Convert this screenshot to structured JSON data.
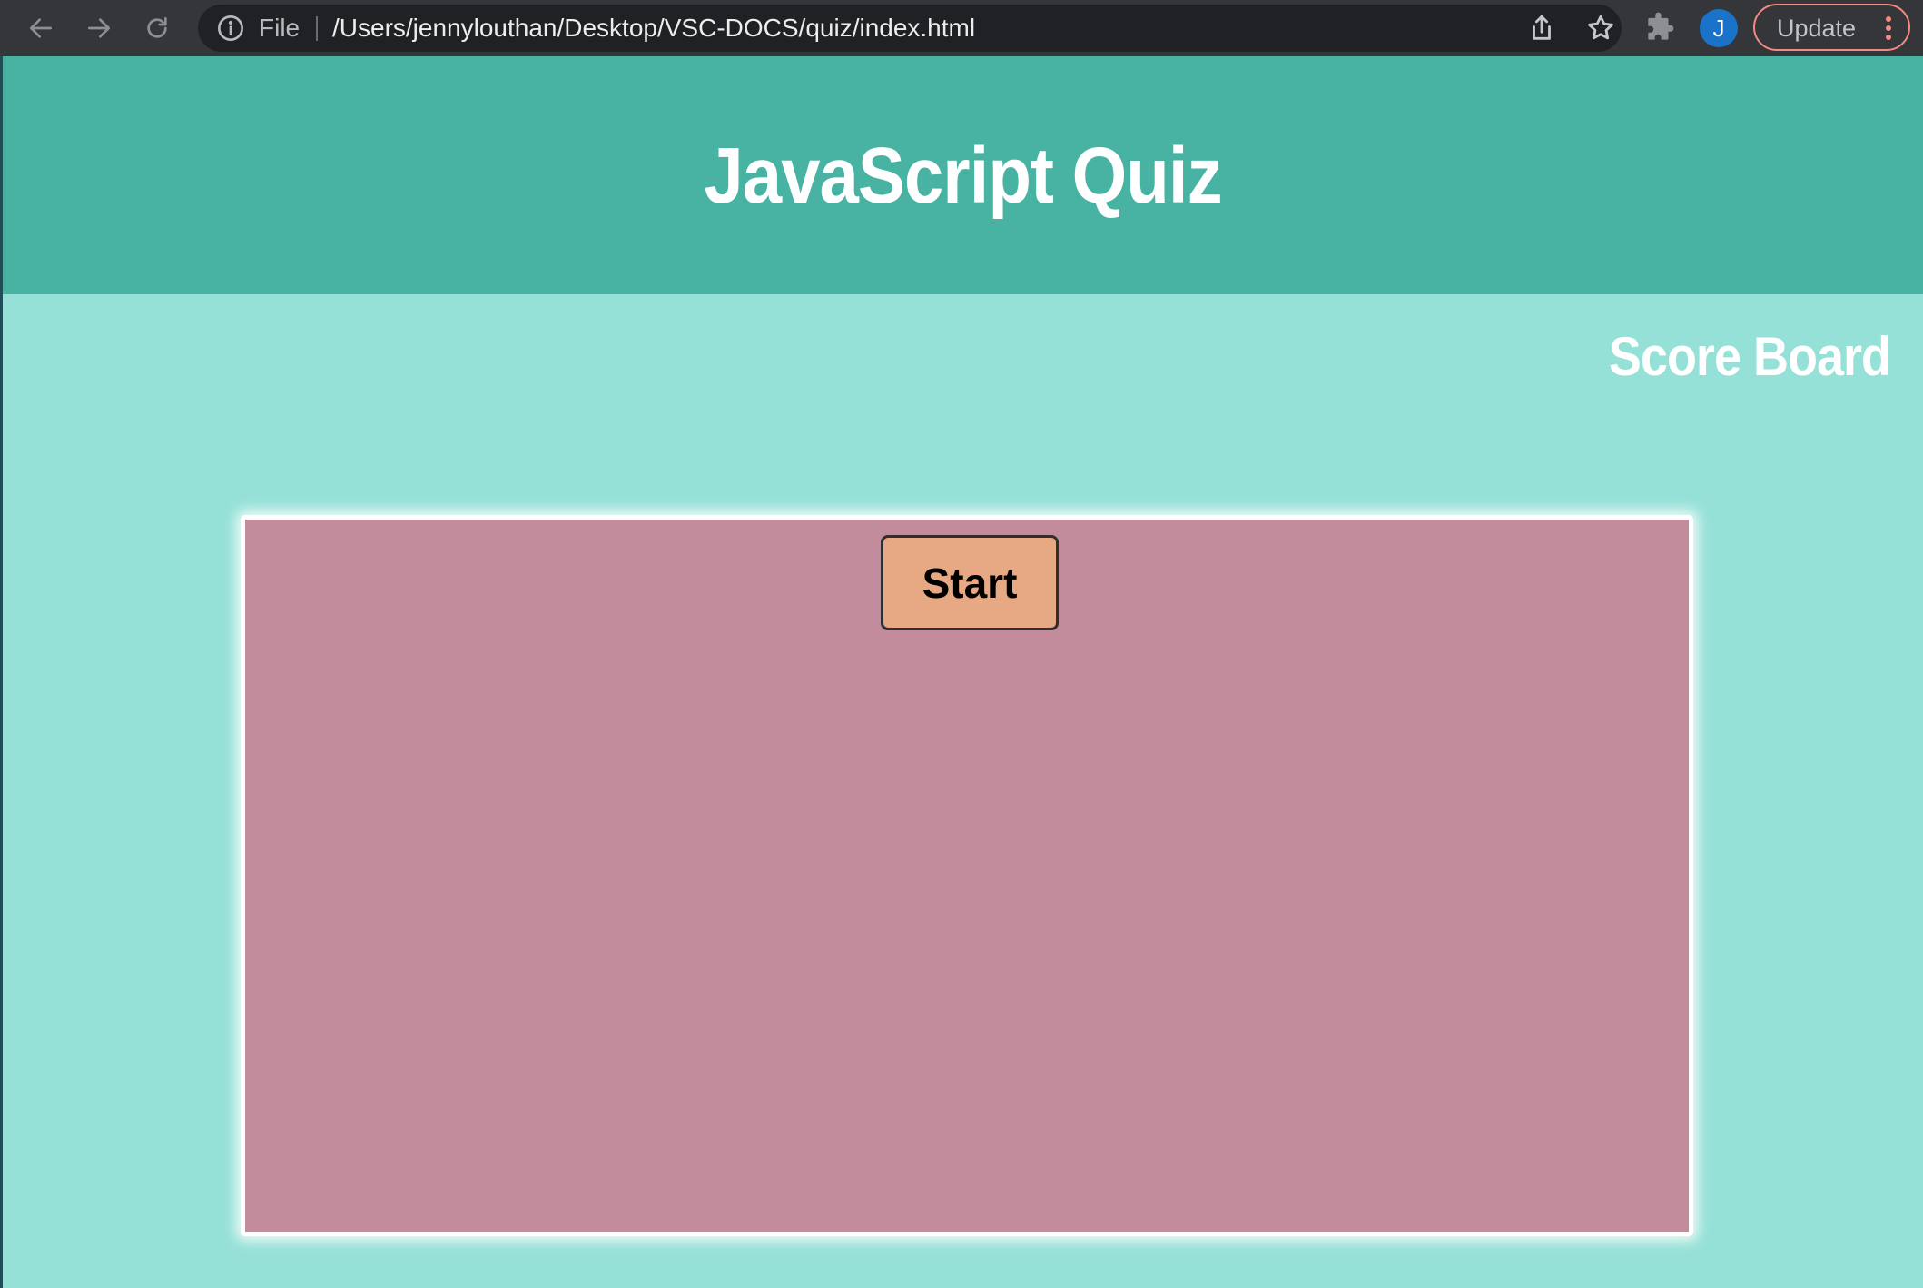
{
  "browser": {
    "back_icon": "arrow-left-icon",
    "forward_icon": "arrow-right-icon",
    "reload_icon": "reload-icon",
    "omnibox": {
      "scheme_label": "File",
      "url": "/Users/jennylouthan/Desktop/VSC-DOCS/quiz/index.html"
    },
    "profile_initial": "J",
    "update_label": "Update",
    "colors": {
      "chrome_bg": "#35363a",
      "omnibox_bg": "#202124",
      "avatar": "#1a73c9",
      "update_border": "#f28b82"
    }
  },
  "page": {
    "title": "JavaScript Quiz",
    "scoreboard_label": "Score Board",
    "start_label": "Start",
    "colors": {
      "header_bg": "#48b3a3",
      "page_bg": "#96e1d7",
      "card_bg": "#c28c9c",
      "start_bg": "#e6a984"
    }
  }
}
